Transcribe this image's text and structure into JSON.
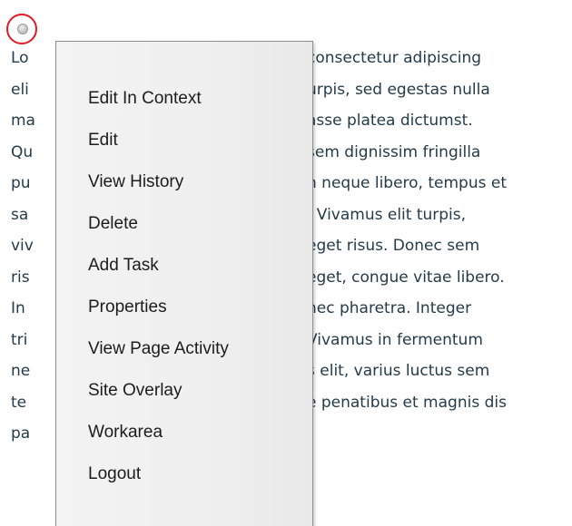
{
  "trigger": {
    "icon": "gray-circle-icon",
    "ring_color": "#e21b23"
  },
  "content": {
    "visible_lines": [
      {
        "left": "Lo",
        "right": "consectetur adipiscing"
      },
      {
        "left": "eli",
        "right": "urpis, sed egestas nulla"
      },
      {
        "left": "ma",
        "right": "asse platea dictumst."
      },
      {
        "left": "Qu",
        "right": "sem dignissim fringilla"
      },
      {
        "left": "pu",
        "right": "n neque libero, tempus et"
      },
      {
        "left": "sa",
        "right": ". Vivamus elit turpis,"
      },
      {
        "left": "viv",
        "right": "eget risus. Donec sem"
      },
      {
        "left": "ris",
        "right": "eget, congue vitae libero."
      },
      {
        "left": "In",
        "right": "nec pharetra. Integer"
      },
      {
        "left": "tri",
        "right": "Vivamus in fermentum"
      },
      {
        "left": "ne",
        "right": "s elit, varius luctus sem"
      },
      {
        "left": "te",
        "right": "e penatibus et magnis dis"
      },
      {
        "left": "pa",
        "right": ""
      }
    ]
  },
  "menu": {
    "items": [
      {
        "label": "Edit In Context"
      },
      {
        "label": "Edit"
      },
      {
        "label": "View History"
      },
      {
        "label": "Delete"
      },
      {
        "label": "Add Task"
      },
      {
        "label": "Properties"
      },
      {
        "label": "View Page Activity"
      },
      {
        "label": "Site Overlay"
      },
      {
        "label": "Workarea"
      },
      {
        "label": "Logout"
      }
    ]
  }
}
